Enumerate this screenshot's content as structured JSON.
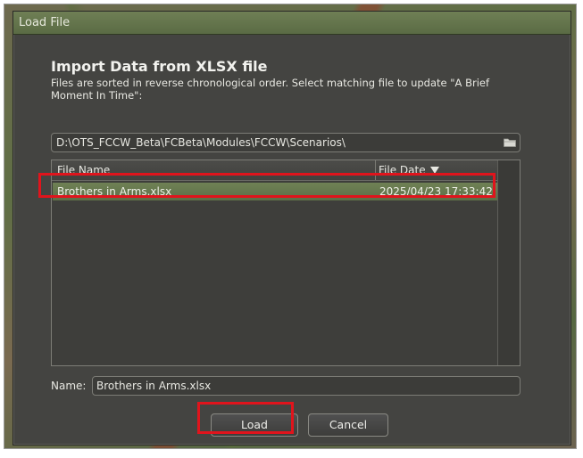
{
  "window": {
    "title": "Load File"
  },
  "dialog": {
    "heading": "Import Data from XLSX file",
    "description": "Files are sorted in reverse chronological order.  Select matching file to update \"A Brief Moment In Time\":"
  },
  "path": {
    "value": "D:\\OTS_FCCW_Beta\\FCBeta\\Modules\\FCCW\\Scenarios\\",
    "icon": "folder-icon"
  },
  "file_list": {
    "columns": [
      "File Name",
      "File Date"
    ],
    "sort_icon": "sort-descending-icon",
    "rows": [
      {
        "name": "Brothers in Arms.xlsx",
        "date": "2025/04/23 17:33:42",
        "selected": true
      }
    ]
  },
  "name_field": {
    "label": "Name:",
    "value": "Brothers in Arms.xlsx"
  },
  "buttons": {
    "load": "Load",
    "cancel": "Cancel"
  },
  "colors": {
    "title_bar": "#5f7048",
    "selection": "#66784e",
    "highlight_box": "#e0141c",
    "dialog_bg": "#444441"
  }
}
